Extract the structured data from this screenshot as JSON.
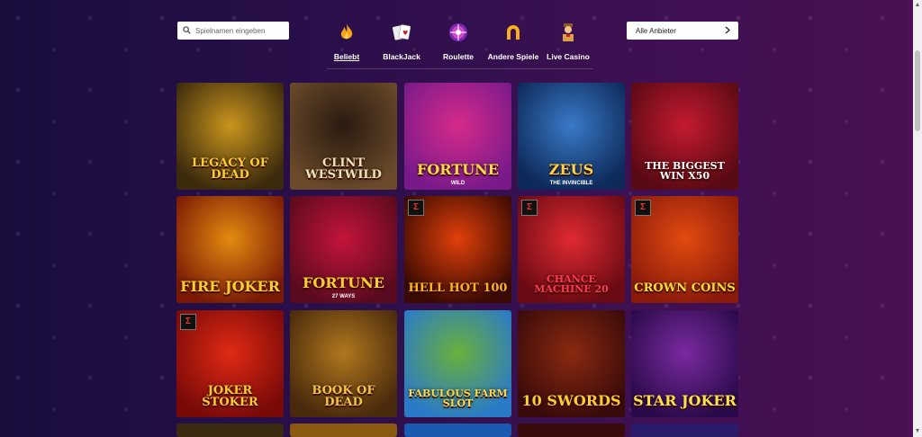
{
  "search": {
    "placeholder": "Spielnamen eingeben"
  },
  "categories": [
    {
      "label": "Beliebt",
      "icon": "flame-icon",
      "active": true
    },
    {
      "label": "BlackJack",
      "icon": "playing-cards-icon",
      "active": false
    },
    {
      "label": "Roulette",
      "icon": "roulette-wheel-icon",
      "active": false
    },
    {
      "label": "Andere Spiele",
      "icon": "horseshoe-icon",
      "active": false
    },
    {
      "label": "Live Casino",
      "icon": "dealer-icon",
      "active": false
    }
  ],
  "provider": {
    "label": "Alle Anbieter",
    "icon": "chevron-right-icon"
  },
  "games": [
    {
      "title": "LEGACY OF DEAD",
      "sub": "",
      "colors": [
        "#3b2a0c",
        "#c9951d"
      ],
      "tcolor": "#ffcc33"
    },
    {
      "title": "CLINT WESTWILD",
      "sub": "",
      "colors": [
        "#6a4a2a",
        "#2a1a10"
      ],
      "tcolor": "#f3e1b5"
    },
    {
      "title": "FORTUNE",
      "sub": "WILD",
      "colors": [
        "#7a1a8a",
        "#d62a8a"
      ],
      "tcolor": "#ffd84a"
    },
    {
      "title": "ZEUS",
      "sub": "THE INVINCIBLE",
      "colors": [
        "#0d2a5a",
        "#3a7ac8"
      ],
      "tcolor": "#ffd24a"
    },
    {
      "title": "THE BIGGEST WIN X50",
      "sub": "",
      "colors": [
        "#5a0a14",
        "#c41a30"
      ],
      "tcolor": "#ffffff"
    },
    {
      "title": "FIRE JOKER",
      "sub": "",
      "colors": [
        "#7a1a05",
        "#e58a10"
      ],
      "tcolor": "#ffcc33"
    },
    {
      "title": "FORTUNE",
      "sub": "27 WAYS",
      "colors": [
        "#5a0a1e",
        "#c4143a"
      ],
      "tcolor": "#ffcc33"
    },
    {
      "title": "HELL HOT 100",
      "sub": "",
      "colors": [
        "#3a0a02",
        "#e0400a"
      ],
      "tcolor": "#ffb020"
    },
    {
      "title": "CHANCE MACHINE 20",
      "sub": "",
      "colors": [
        "#6a0a14",
        "#e02a30"
      ],
      "tcolor": "#ff3a50"
    },
    {
      "title": "CROWN COINS",
      "sub": "",
      "colors": [
        "#8a1a0a",
        "#e34a10"
      ],
      "tcolor": "#ffdd33"
    },
    {
      "title": "JOKER STOKER",
      "sub": "",
      "colors": [
        "#7a0a08",
        "#e02a14"
      ],
      "tcolor": "#ffcc33"
    },
    {
      "title": "BOOK OF DEAD",
      "sub": "",
      "colors": [
        "#4a2a0c",
        "#b0781e"
      ],
      "tcolor": "#f5c24a"
    },
    {
      "title": "FABULOUS FARM SLOT",
      "sub": "",
      "colors": [
        "#2a7ac8",
        "#6ab03a"
      ],
      "tcolor": "#ffd84a"
    },
    {
      "title": "10 SWORDS",
      "sub": "",
      "colors": [
        "#3a0a0a",
        "#8a2a10"
      ],
      "tcolor": "#ffcc33"
    },
    {
      "title": "STAR JOKER",
      "sub": "",
      "colors": [
        "#2a0a4a",
        "#7a2aa0"
      ],
      "tcolor": "#ffe04a"
    }
  ]
}
